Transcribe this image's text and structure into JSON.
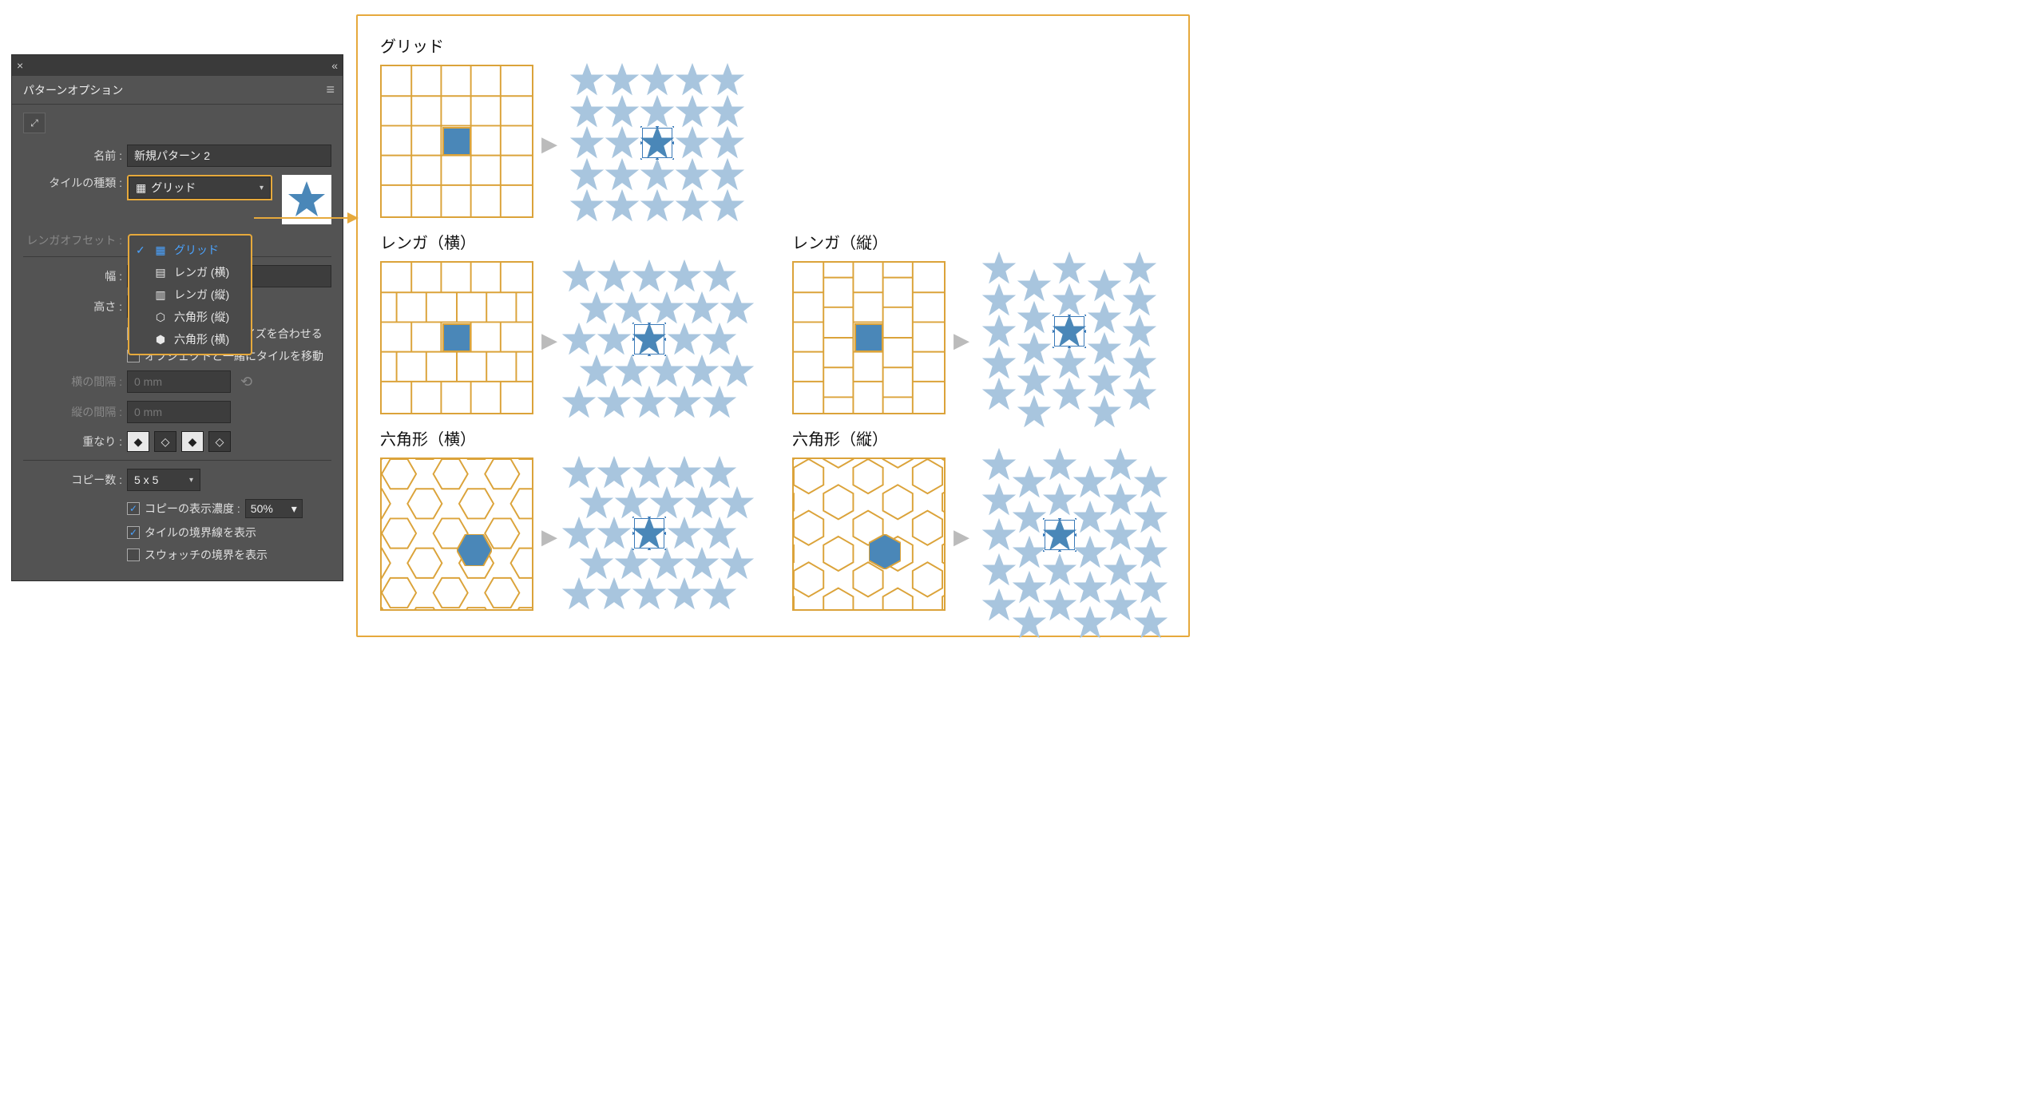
{
  "panel": {
    "title": "パターンオプション",
    "name_label": "名前 :",
    "name_value": "新規パターン 2",
    "tile_type_label": "タイルの種類 :",
    "tile_type_value": "グリッド",
    "brick_offset_label": "レンガオフセット :",
    "width_label": "幅 :",
    "height_label": "高さ :",
    "fit_tile_label": "タイルをアートのサイズを合わせる",
    "move_tile_label": "オブジェクトと一緒にタイルを移動",
    "h_spacing_label": "横の間隔 :",
    "h_spacing_value": "0 mm",
    "v_spacing_label": "縦の間隔 :",
    "v_spacing_value": "0 mm",
    "overlap_label": "重なり :",
    "copies_label": "コピー数 :",
    "copies_value": "5 x 5",
    "copy_dim_label": "コピーの表示濃度 :",
    "copy_dim_value": "50%",
    "show_tile_edge": "タイルの境界線を表示",
    "show_swatch_bounds": "スウォッチの境界を表示"
  },
  "dropdown": {
    "items": [
      {
        "label": "グリッド",
        "icon": "grid",
        "selected": true
      },
      {
        "label": "レンガ (横)",
        "icon": "brick-h",
        "selected": false
      },
      {
        "label": "レンガ (縦)",
        "icon": "brick-v",
        "selected": false
      },
      {
        "label": "六角形 (縦)",
        "icon": "hex-v",
        "selected": false
      },
      {
        "label": "六角形 (横)",
        "icon": "hex-h",
        "selected": false
      }
    ]
  },
  "examples": {
    "grid": "グリッド",
    "brick_h": "レンガ（横）",
    "brick_v": "レンガ（縦）",
    "hex_h": "六角形（横）",
    "hex_v": "六角形（縦）"
  },
  "colors": {
    "accent": "#e6a93c",
    "star_faded": "#a8c5de",
    "star_solid": "#4a87b8"
  }
}
